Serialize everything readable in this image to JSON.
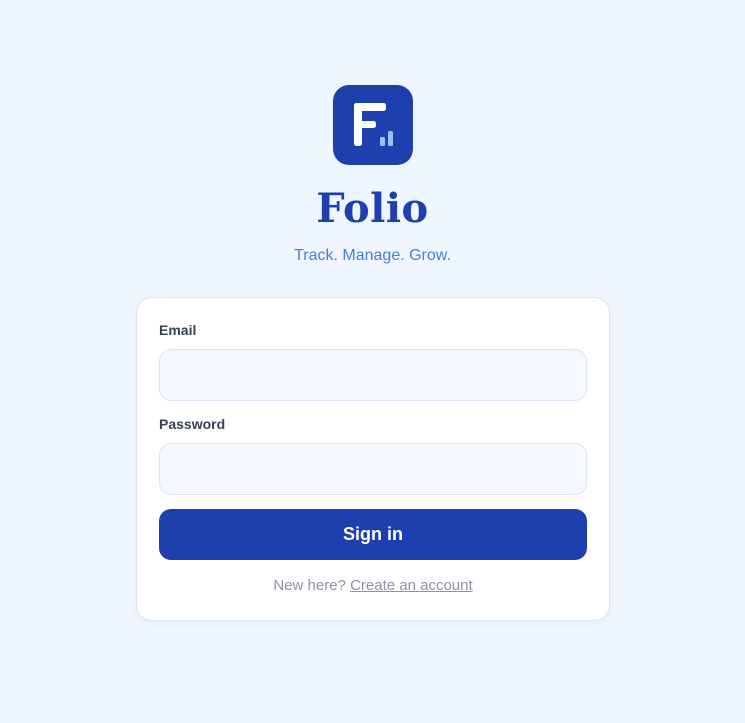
{
  "brand": {
    "name": "Folio",
    "tagline": "Track. Manage. Grow.",
    "logo_icon": "folio-logo-icon",
    "accent_color": "#1e40af",
    "background_color": "#eff6ff"
  },
  "login_form": {
    "email_label": "Email",
    "email_value": "",
    "email_placeholder": "",
    "password_label": "Password",
    "password_value": "",
    "password_placeholder": "",
    "submit_label": "Sign in",
    "signup_prompt": "New here?",
    "signup_link": "Create an account"
  }
}
